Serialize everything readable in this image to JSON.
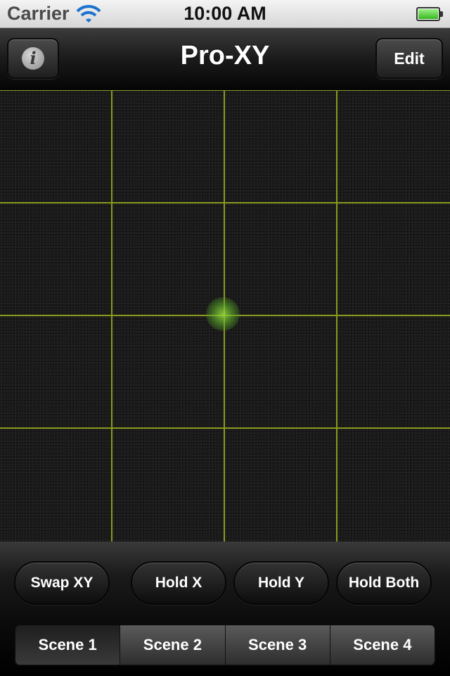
{
  "status_bar": {
    "carrier": "Carrier",
    "time": "10:00 AM"
  },
  "nav": {
    "title": "Pro-XY",
    "info_label": "i",
    "edit_label": "Edit"
  },
  "pad": {
    "columns": 4,
    "rows": 4,
    "grid_color": "#8a9a1c",
    "cursor_color": "#7fc83a",
    "cursor_x": 0.5,
    "cursor_y": 0.5
  },
  "hold_buttons": {
    "swap": "Swap XY",
    "hold_x": "Hold X",
    "hold_y": "Hold Y",
    "hold_both": "Hold Both"
  },
  "scenes": [
    "Scene 1",
    "Scene 2",
    "Scene 3",
    "Scene 4"
  ],
  "selected_scene": "Scene 1"
}
